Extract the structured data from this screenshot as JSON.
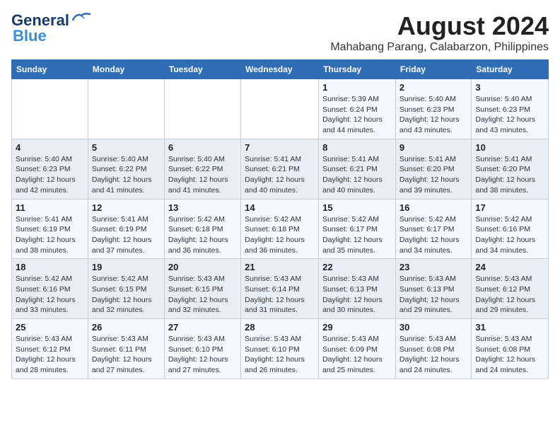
{
  "logo": {
    "line1": "General",
    "line2": "Blue"
  },
  "title": "August 2024",
  "subtitle": "Mahabang Parang, Calabarzon, Philippines",
  "days_of_week": [
    "Sunday",
    "Monday",
    "Tuesday",
    "Wednesday",
    "Thursday",
    "Friday",
    "Saturday"
  ],
  "weeks": [
    [
      {
        "day": "",
        "info": ""
      },
      {
        "day": "",
        "info": ""
      },
      {
        "day": "",
        "info": ""
      },
      {
        "day": "",
        "info": ""
      },
      {
        "day": "1",
        "info": "Sunrise: 5:39 AM\nSunset: 6:24 PM\nDaylight: 12 hours\nand 44 minutes."
      },
      {
        "day": "2",
        "info": "Sunrise: 5:40 AM\nSunset: 6:23 PM\nDaylight: 12 hours\nand 43 minutes."
      },
      {
        "day": "3",
        "info": "Sunrise: 5:40 AM\nSunset: 6:23 PM\nDaylight: 12 hours\nand 43 minutes."
      }
    ],
    [
      {
        "day": "4",
        "info": "Sunrise: 5:40 AM\nSunset: 6:23 PM\nDaylight: 12 hours\nand 42 minutes."
      },
      {
        "day": "5",
        "info": "Sunrise: 5:40 AM\nSunset: 6:22 PM\nDaylight: 12 hours\nand 41 minutes."
      },
      {
        "day": "6",
        "info": "Sunrise: 5:40 AM\nSunset: 6:22 PM\nDaylight: 12 hours\nand 41 minutes."
      },
      {
        "day": "7",
        "info": "Sunrise: 5:41 AM\nSunset: 6:21 PM\nDaylight: 12 hours\nand 40 minutes."
      },
      {
        "day": "8",
        "info": "Sunrise: 5:41 AM\nSunset: 6:21 PM\nDaylight: 12 hours\nand 40 minutes."
      },
      {
        "day": "9",
        "info": "Sunrise: 5:41 AM\nSunset: 6:20 PM\nDaylight: 12 hours\nand 39 minutes."
      },
      {
        "day": "10",
        "info": "Sunrise: 5:41 AM\nSunset: 6:20 PM\nDaylight: 12 hours\nand 38 minutes."
      }
    ],
    [
      {
        "day": "11",
        "info": "Sunrise: 5:41 AM\nSunset: 6:19 PM\nDaylight: 12 hours\nand 38 minutes."
      },
      {
        "day": "12",
        "info": "Sunrise: 5:41 AM\nSunset: 6:19 PM\nDaylight: 12 hours\nand 37 minutes."
      },
      {
        "day": "13",
        "info": "Sunrise: 5:42 AM\nSunset: 6:18 PM\nDaylight: 12 hours\nand 36 minutes."
      },
      {
        "day": "14",
        "info": "Sunrise: 5:42 AM\nSunset: 6:18 PM\nDaylight: 12 hours\nand 36 minutes."
      },
      {
        "day": "15",
        "info": "Sunrise: 5:42 AM\nSunset: 6:17 PM\nDaylight: 12 hours\nand 35 minutes."
      },
      {
        "day": "16",
        "info": "Sunrise: 5:42 AM\nSunset: 6:17 PM\nDaylight: 12 hours\nand 34 minutes."
      },
      {
        "day": "17",
        "info": "Sunrise: 5:42 AM\nSunset: 6:16 PM\nDaylight: 12 hours\nand 34 minutes."
      }
    ],
    [
      {
        "day": "18",
        "info": "Sunrise: 5:42 AM\nSunset: 6:16 PM\nDaylight: 12 hours\nand 33 minutes."
      },
      {
        "day": "19",
        "info": "Sunrise: 5:42 AM\nSunset: 6:15 PM\nDaylight: 12 hours\nand 32 minutes."
      },
      {
        "day": "20",
        "info": "Sunrise: 5:43 AM\nSunset: 6:15 PM\nDaylight: 12 hours\nand 32 minutes."
      },
      {
        "day": "21",
        "info": "Sunrise: 5:43 AM\nSunset: 6:14 PM\nDaylight: 12 hours\nand 31 minutes."
      },
      {
        "day": "22",
        "info": "Sunrise: 5:43 AM\nSunset: 6:13 PM\nDaylight: 12 hours\nand 30 minutes."
      },
      {
        "day": "23",
        "info": "Sunrise: 5:43 AM\nSunset: 6:13 PM\nDaylight: 12 hours\nand 29 minutes."
      },
      {
        "day": "24",
        "info": "Sunrise: 5:43 AM\nSunset: 6:12 PM\nDaylight: 12 hours\nand 29 minutes."
      }
    ],
    [
      {
        "day": "25",
        "info": "Sunrise: 5:43 AM\nSunset: 6:12 PM\nDaylight: 12 hours\nand 28 minutes."
      },
      {
        "day": "26",
        "info": "Sunrise: 5:43 AM\nSunset: 6:11 PM\nDaylight: 12 hours\nand 27 minutes."
      },
      {
        "day": "27",
        "info": "Sunrise: 5:43 AM\nSunset: 6:10 PM\nDaylight: 12 hours\nand 27 minutes."
      },
      {
        "day": "28",
        "info": "Sunrise: 5:43 AM\nSunset: 6:10 PM\nDaylight: 12 hours\nand 26 minutes."
      },
      {
        "day": "29",
        "info": "Sunrise: 5:43 AM\nSunset: 6:09 PM\nDaylight: 12 hours\nand 25 minutes."
      },
      {
        "day": "30",
        "info": "Sunrise: 5:43 AM\nSunset: 6:08 PM\nDaylight: 12 hours\nand 24 minutes."
      },
      {
        "day": "31",
        "info": "Sunrise: 5:43 AM\nSunset: 6:08 PM\nDaylight: 12 hours\nand 24 minutes."
      }
    ]
  ]
}
